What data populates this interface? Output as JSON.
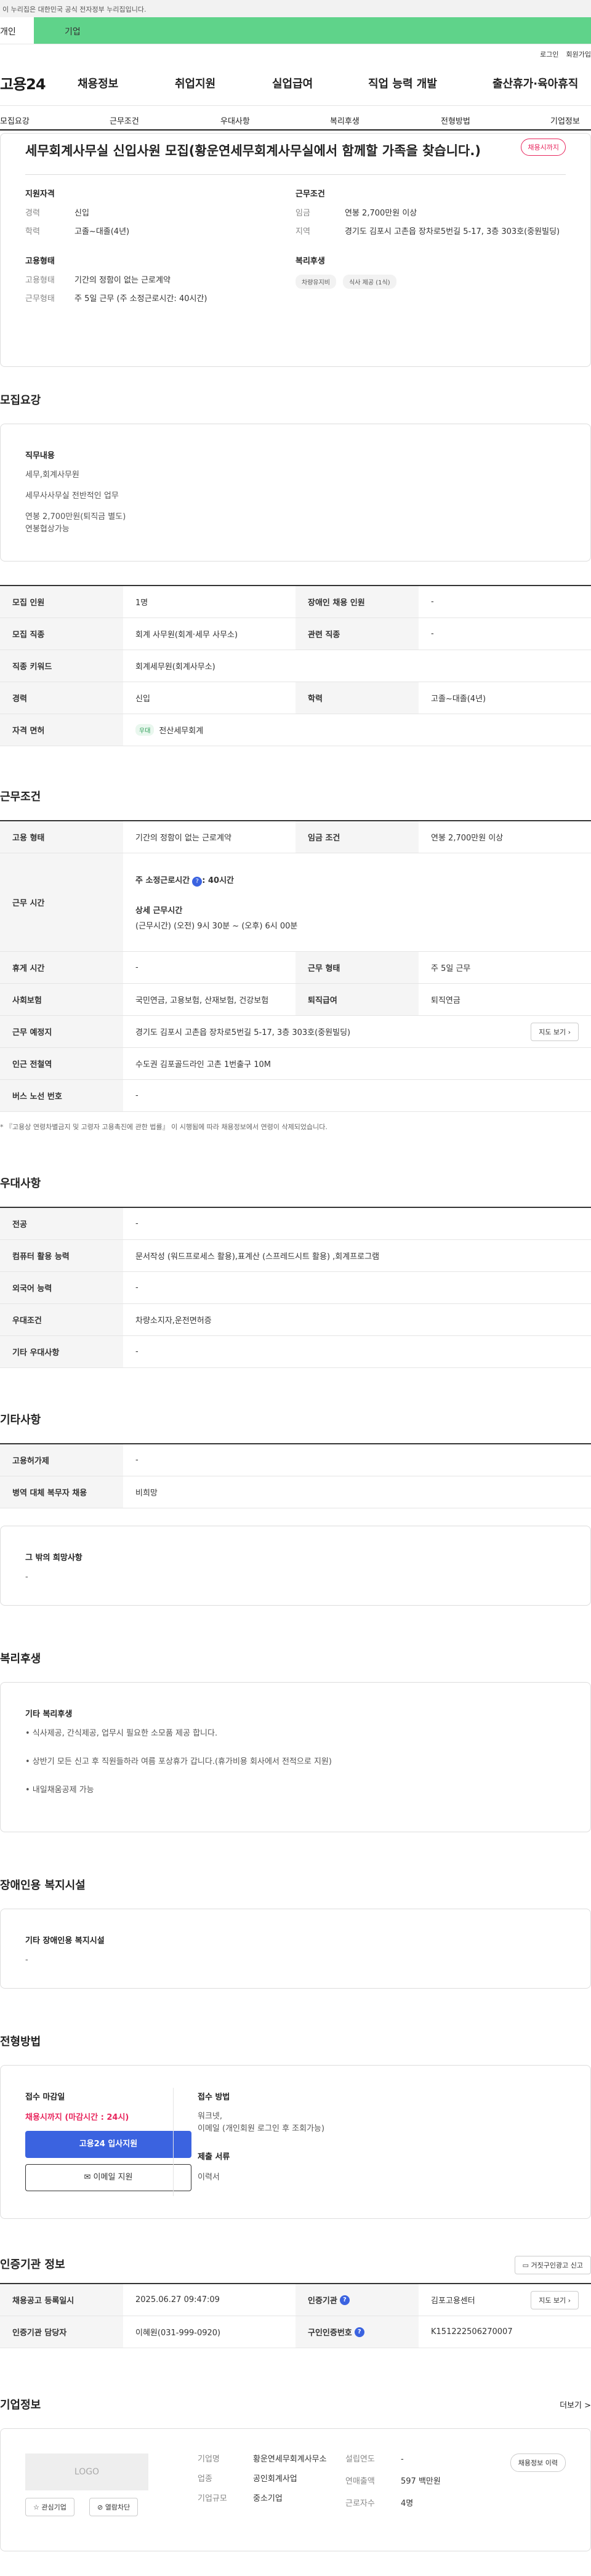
{
  "gov_banner": "이 누리집은 대한민국 공식 전자정부 누리집입니다.",
  "tabs": {
    "personal": "개인",
    "company": "기업"
  },
  "util": {
    "login": "로그인",
    "join": "회원가입"
  },
  "gnb": {
    "logo": "고용24",
    "items": [
      "채용정보",
      "취업지원",
      "실업급여",
      "직업 능력 개발",
      "출산휴가·육아휴직"
    ]
  },
  "anchors": [
    "모집요강",
    "근무조건",
    "우대사항",
    "복리후생",
    "전형방법",
    "기업정보"
  ],
  "summary": {
    "title": "세무회계사무실 신입사원 모집(황운연세무회계사무실에서 함께할 가족을 찾습니다.)",
    "badge": "채용시까지",
    "qual_h": "지원자격",
    "qual": [
      {
        "k": "경력",
        "v": "신입"
      },
      {
        "k": "학력",
        "v": "고졸~대졸(4년)"
      }
    ],
    "cond_h": "근무조건",
    "cond": [
      {
        "k": "임금",
        "v": "연봉 2,700만원 이상"
      },
      {
        "k": "지역",
        "v": "경기도 김포시 고촌읍 장차로5번길 5-17, 3층 303호(중원빌딩)"
      }
    ],
    "emp_h": "고용형태",
    "emp": [
      {
        "k": "고용형태",
        "v": "기간의 정함이 없는 근로계약"
      },
      {
        "k": "근무형태",
        "v": "주 5일 근무 (주 소정근로시간: 40시간)"
      }
    ],
    "welfare_h": "복리후생",
    "welfare_chips": [
      "차량유지비",
      "식사 제공 (1식)"
    ]
  },
  "recruit": {
    "title": "모집요강",
    "duty_h": "직무내용",
    "duty_lines": [
      "세무,회계사무원",
      "세무사사무실 전반적인 업무",
      "연봉 2,700만원(퇴직금 별도)",
      "연봉협상가능"
    ],
    "rows": [
      {
        "th1": "모집 인원",
        "td1": "1명",
        "th2": "장애인 채용 인원",
        "td2": "-"
      },
      {
        "th1": "모집 직종",
        "td1": "회계 사무원(회계·세무 사무소)",
        "th2": "관련 직종",
        "td2": "-"
      }
    ],
    "keyword_th": "직종 키워드",
    "keyword_td": "회계세무원(회계사무소)",
    "career_th": "경력",
    "career_td": "신입",
    "edu_th": "학력",
    "edu_td": "고졸~대졸(4년)",
    "license_th": "자격 면허",
    "license_chip": "우대",
    "license_td": "전산세무회계"
  },
  "work": {
    "title": "근무조건",
    "type_th": "고용 형태",
    "type_td": "기간의 정함이 없는 근로계약",
    "wage_th": "임금 조건",
    "wage_td": "연봉 2,700만원 이상",
    "hours_th": "근무 시간",
    "hours_h1": "주 소정근로시간",
    "hours_q": "?",
    "hours_v1": ": 40시간",
    "hours_h2": "상세 근무시간",
    "hours_v2": "(근무시간) (오전) 9시 30분 ~ (오후) 6시 00분",
    "rest_th": "휴게 시간",
    "rest_td": "-",
    "form_th": "근무 형태",
    "form_td": "주 5일 근무",
    "ins_th": "사회보험",
    "ins_td": "국민연금, 고용보험, 산재보험, 건강보험",
    "pension_th": "퇴직급여",
    "pension_td": "퇴직연금",
    "place_th": "근무 예정지",
    "place_td": "경기도 김포시 고촌읍 장차로5번길 5-17, 3층 303호(중원빌딩)",
    "map_btn": "지도 보기",
    "subway_th": "인근 전철역",
    "subway_td": "수도권 김포골드라인 고촌 1번출구 10M",
    "bus_th": "버스 노선 번호",
    "bus_td": "-",
    "note": "* 『고용상 연령차별금지 및 고령자 고용촉진에 관한 법률』 이 시행됨에 따라 채용정보에서 연령이 삭제되었습니다."
  },
  "pref": {
    "title": "우대사항",
    "rows": [
      {
        "th": "전공",
        "td": "-"
      },
      {
        "th": "컴퓨터 활용 능력",
        "td": "문서작성 (워드프로세스 활용),표계산 (스프레드시트 활용) ,회계프로그램"
      },
      {
        "th": "외국어 능력",
        "td": "-"
      },
      {
        "th": "우대조건",
        "td": "차량소지자,운전면허증"
      },
      {
        "th": "기타 우대사항",
        "td": "-"
      }
    ]
  },
  "etc": {
    "title": "기타사항",
    "rows": [
      {
        "th": "고용허가제",
        "td": "-"
      },
      {
        "th": "병역 대체 복무자 채용",
        "td": "비희망"
      }
    ],
    "other_h": "그 밖의 희망사항",
    "other_v": "-"
  },
  "welfare": {
    "title": "복리후생",
    "h": "기타 복리후생",
    "items": [
      "• 식사제공, 간식제공, 업무시 필요한 소모품 제공 합니다.",
      "• 상반기 모든 신고 후 직원들하라 여름 포상휴가 갑니다.(휴가비용 회사에서 전적으로 지원)",
      "• 내일채움공제 가능"
    ]
  },
  "disabled": {
    "title": "장애인용 복지시설",
    "h": "기타 장애인용 복지시설",
    "v": "-"
  },
  "process": {
    "title": "전형방법",
    "deadline_h": "접수 마감일",
    "deadline_v": "채용시까지 (마감시간 : 24시)",
    "apply_btn": "고용24 입사지원",
    "email_btn": "이메일 지원",
    "method_h": "접수 방법",
    "method_v1": "워크넷,",
    "method_v2": "이메일 (개인회원 로그인 후 조회가능)",
    "docs_h": "제출 서류",
    "docs_v": "이력서"
  },
  "cert": {
    "title": "인증기관 정보",
    "report_btn": "거짓구인광고 신고",
    "reg_th": "채용공고 등록일시",
    "reg_td": "2025.06.27 09:47:09",
    "org_th": "인증기관",
    "org_td": "김포고용센터",
    "map_btn": "지도 보기",
    "mgr_th": "인증기관 담당자",
    "mgr_td": "이혜원(031-999-0920)",
    "num_th": "구인인증번호",
    "num_td": "K151222506270007",
    "q": "?"
  },
  "company": {
    "title": "기업정보",
    "more": "더보기 >",
    "logo": "LOGO",
    "fav_btn": "관심기업",
    "block_btn": "열람차단",
    "name_k": "기업명",
    "name_v": "황운연세무회계사무소",
    "type_k": "업종",
    "type_v": "공인회계사업",
    "size_k": "기업규모",
    "size_v": "중소기업",
    "est_k": "설립연도",
    "est_v": "-",
    "sales_k": "연매출액",
    "sales_v": "597 백만원",
    "emp_k": "근로자수",
    "emp_v": "4명",
    "history_btn": "채용정보 이력"
  }
}
